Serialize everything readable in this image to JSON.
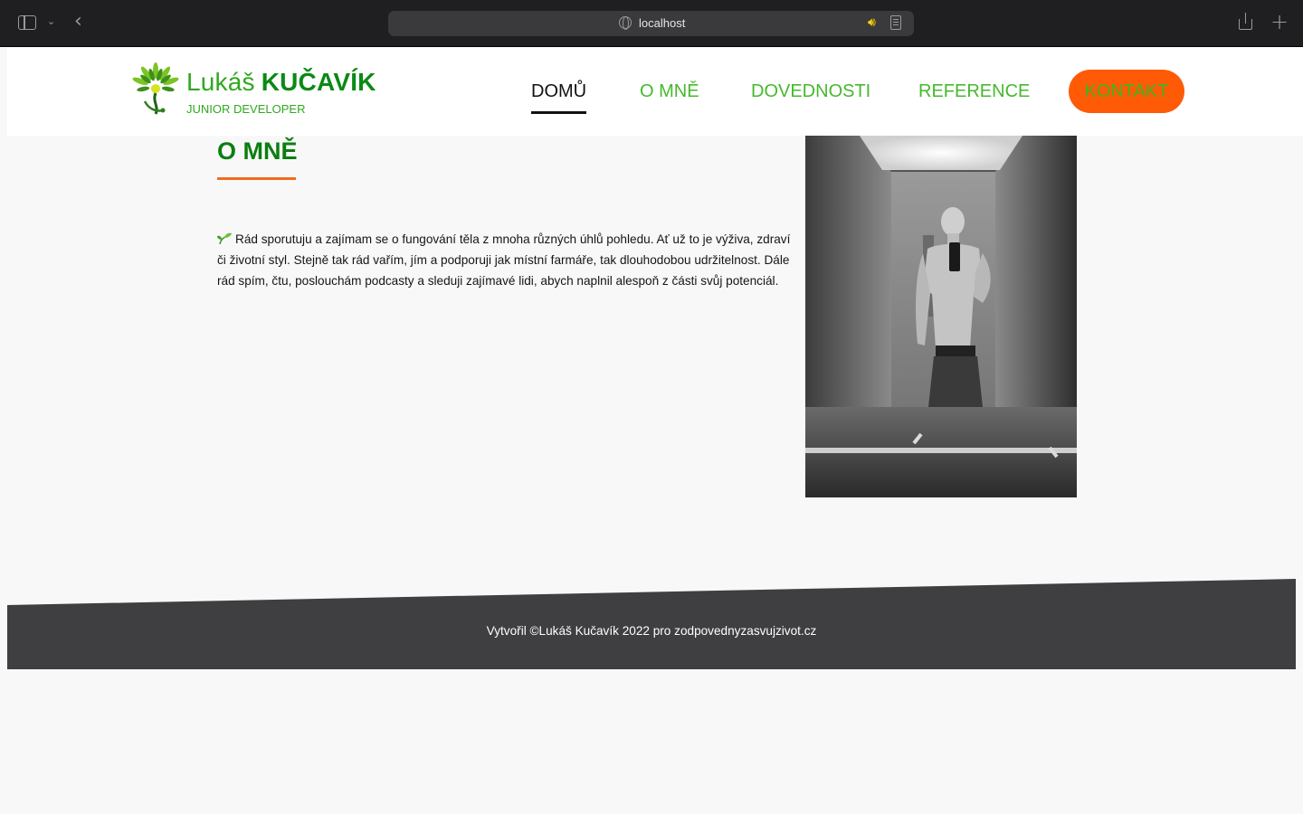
{
  "browser": {
    "url": "localhost",
    "icons": [
      "sidebar-icon",
      "chevron-down-icon",
      "back-icon",
      "globe-icon",
      "speaker-icon",
      "reader-icon",
      "share-icon",
      "plus-icon"
    ]
  },
  "logo": {
    "first_name": "Lukáš",
    "last_name": "KUČAVÍK",
    "subtitle": "JUNIOR DEVELOPER"
  },
  "nav": {
    "items": [
      {
        "label": "DOMŮ",
        "active": true
      },
      {
        "label": "O MNĚ",
        "active": false
      },
      {
        "label": "DOVEDNOSTI",
        "active": false
      },
      {
        "label": "REFERENCE",
        "active": false
      }
    ],
    "contact_label": "KONTAKT"
  },
  "about": {
    "title": "O MNĚ",
    "text": "Rád sporutuju a zajímam se o fungování těla z mnoha různých úhlů pohledu. Ať už to je výživa, zdraví či životní styl. Stejně tak rád vařím, jím a podporuji jak místní farmáře, tak dlouhodobou udržitelnost. Dále rád spím, čtu, poslouchám podcasty a sleduji zajímavé lidi, abych naplnil alespoň z části svůj potenciál."
  },
  "footer": {
    "text": "Vytvořil ©Lukáš Kučavík 2022 pro zodpovednyzasvujzivot.cz"
  },
  "colors": {
    "brand_green": "#2fa81f",
    "dark_green": "#0b7e12",
    "accent_orange": "#ff5a05",
    "footer_bg": "#3f3f42"
  }
}
